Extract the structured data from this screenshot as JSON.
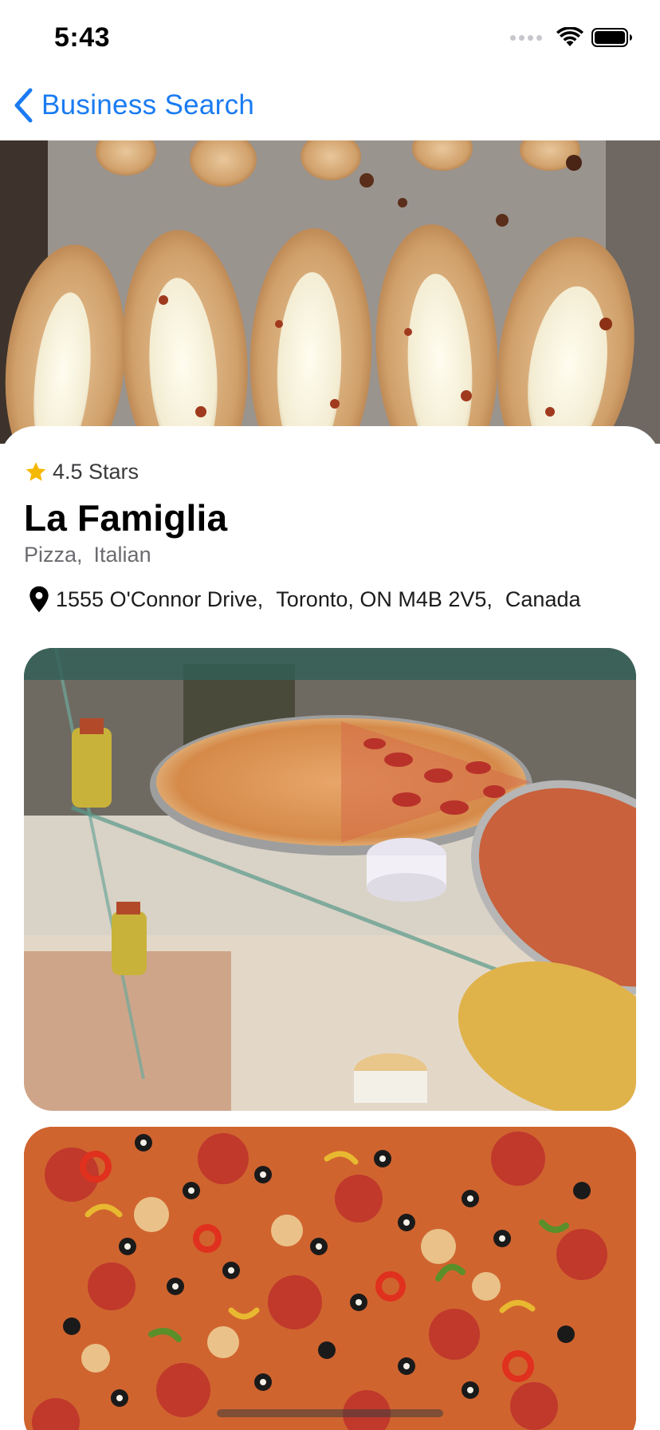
{
  "status_bar": {
    "time": "5:43"
  },
  "nav": {
    "back_label": "Business Search"
  },
  "business": {
    "rating_text": "4.5 Stars",
    "name": "La Famiglia",
    "categories": [
      "Pizza,",
      "Italian"
    ],
    "address_parts": [
      "1555 O'Connor Drive,",
      "Toronto, ON M4B 2V5,",
      "Canada"
    ]
  },
  "colors": {
    "accent": "#1a7bf2",
    "star": "#f5b800"
  },
  "icons": {
    "back": "chevron-left-icon",
    "star": "star-icon",
    "location": "map-pin-icon"
  }
}
